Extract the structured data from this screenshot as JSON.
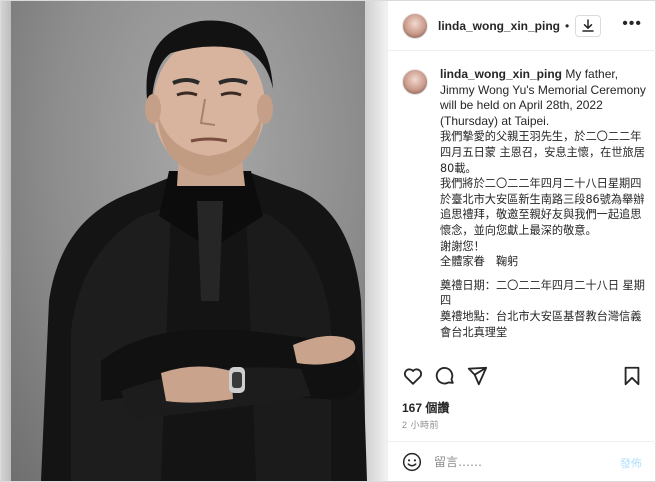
{
  "post": {
    "username": "linda_wong_xin_ping",
    "separator": "•",
    "caption_lines_en": "My father, Jimmy Wong Yu's Memorial Ceremony will be held on April 28th, 2022 (Thursday) at Taipei.",
    "caption_p1": "我們摯愛的父親王羽先生，於二〇二二年四月五日蒙 主恩召，安息主懷，在世旅居80載。",
    "caption_p2": "我們將於二〇二二年四月二十八日星期四於臺北市大安區新生南路三段86號為舉辦追思禮拜，敬邀至親好友與我們一起追思懷念，並向您獻上最深的敬意。",
    "caption_p3": "謝謝您！",
    "caption_p4": "全體家眷　鞠躬",
    "caption_p5": "奠禮日期：二〇二二年四月二十八日 星期四",
    "caption_p6": "奠禮地點：台北市大安區基督教台灣信義會台北真理堂",
    "likes": "167 個讚",
    "time_ago": "2 小時前",
    "comment_placeholder": "留言……",
    "post_button": "發佈"
  },
  "icons": {
    "download": "download-icon",
    "more": "more-options-icon",
    "like": "heart-icon",
    "comment": "comment-icon",
    "share": "share-icon",
    "save": "bookmark-icon",
    "emoji": "emoji-icon"
  },
  "colors": {
    "text": "#262626",
    "muted": "#8e8e8e",
    "border": "#dbdbdb",
    "post_disabled": "#b2dffc"
  }
}
